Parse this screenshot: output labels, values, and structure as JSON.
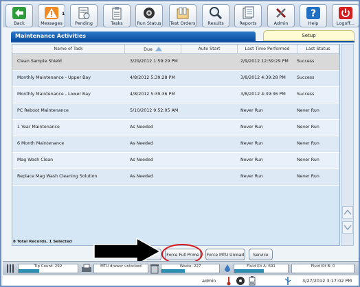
{
  "toolbar": {
    "buttons": [
      {
        "label": "Back",
        "icon": "back-arrow-icon"
      },
      {
        "label": "Messages",
        "icon": "warning-icon",
        "badge": "1"
      },
      {
        "label": "Pending",
        "icon": "pending-icon"
      },
      {
        "label": "Tasks",
        "icon": "clipboard-icon"
      },
      {
        "label": "Run Status",
        "icon": "run-status-icon"
      },
      {
        "label": "Test Orders",
        "icon": "test-orders-icon"
      },
      {
        "label": "Results",
        "icon": "magnifier-icon"
      },
      {
        "label": "Reports",
        "icon": "reports-icon"
      },
      {
        "label": "Admin",
        "icon": "tools-icon"
      },
      {
        "label": "Help",
        "icon": "help-icon"
      },
      {
        "label": "Logoff...",
        "icon": "power-icon"
      }
    ]
  },
  "header": {
    "title": "Maintenance Activities",
    "setup_tab": "Setup"
  },
  "table": {
    "columns": [
      "Name of Task",
      "Due",
      "Auto Start",
      "Last Time Performed",
      "Last Status"
    ],
    "rows": [
      {
        "name": "Clean Sample Shield",
        "due": "3/29/2012 1:59:29 PM",
        "auto": "",
        "last": "2/9/2012 12:59:29 PM",
        "status": "Success"
      },
      {
        "name": "Monthly Maintenance - Upper Bay",
        "due": "4/8/2012 5:39:28 PM",
        "auto": "",
        "last": "3/8/2012 4:39:28 PM",
        "status": "Success"
      },
      {
        "name": "Monthly Maintenance - Lower Bay",
        "due": "4/8/2012 5:39:36 PM",
        "auto": "",
        "last": "3/8/2012 4:39:36 PM",
        "status": "Success"
      },
      {
        "name": "PC Reboot Maintenance",
        "due": "5/10/2012 9:52:05 AM",
        "auto": "",
        "last": "Never Run",
        "status": "Never Run"
      },
      {
        "name": "1 Year Maintenance",
        "due": "As Needed",
        "auto": "",
        "last": "Never Run",
        "status": "Never Run"
      },
      {
        "name": "6 Month Maintenance",
        "due": "As Needed",
        "auto": "",
        "last": "Never Run",
        "status": "Never Run"
      },
      {
        "name": "Mag Wash Clean",
        "due": "As Needed",
        "auto": "",
        "last": "Never Run",
        "status": "Never Run"
      },
      {
        "name": "Replace Mag Wash Cleaning Solution",
        "due": "As Needed",
        "auto": "",
        "last": "Never Run",
        "status": "Never Run"
      }
    ],
    "records_summary": "8 Total Records, 1 Selected"
  },
  "actions": {
    "force_full_prime": "Force Full Prime",
    "force_mtu_unload": "Force MTU Unload",
    "service": "Service"
  },
  "status": {
    "tip_count": "Tip Count: 292",
    "mtu_drawer": "MTU drawer unlocked",
    "waste": "Waste: 227",
    "fluid_a": "Fluid Kit A: 691",
    "fluid_b": "Fluid Kit B: 0",
    "user": "admin",
    "datetime": "3/27/2012 3:17:02 PM",
    "fill_levels": {
      "tip": 0.35,
      "waste": 0.4,
      "fluid_a": 0.55,
      "fluid_b": 0.0
    }
  },
  "colors": {
    "header_blue": "#0b4ea2",
    "row_selected": "#d9d9d9",
    "highlight_ring": "#d8191c"
  }
}
